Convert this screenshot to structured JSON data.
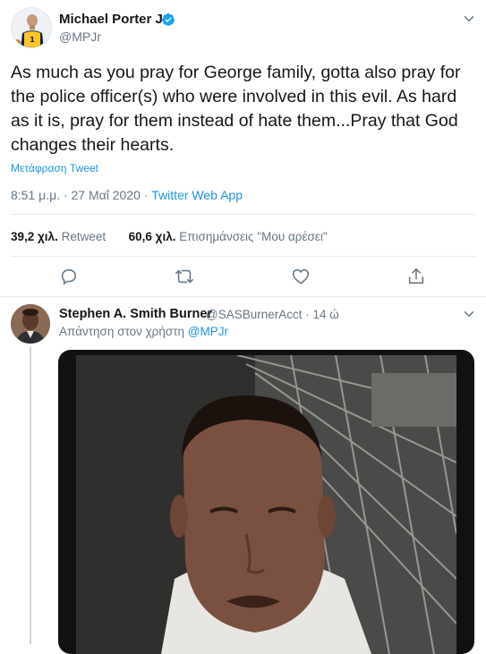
{
  "tweet": {
    "author_name": "Michael Porter Jr",
    "author_handle": "@MPJr",
    "jersey_number": "1",
    "text": "As much as you pray for George family, gotta also pray for the police officer(s) who were involved in this evil. As hard as it is, pray for them instead of hate them...Pray that God changes their hearts.",
    "translate_label": "Μετάφραση Tweet",
    "timestamp": "8:51 μ.μ. · 27 Μαΐ 2020 · ",
    "source_app": "Twitter Web App",
    "retweets_count": "39,2 χιλ.",
    "retweets_label": "Retweet",
    "likes_count": "60,6 χιλ.",
    "likes_label": "Επισημάνσεις \"Μου αρέσει\""
  },
  "reply": {
    "author_name": "Stephen A. Smith Burner",
    "author_handle": "@SASBurnerAcct",
    "time": " · 14 ώ",
    "replying_to_label": "Απάντηση στον χρήστη ",
    "replying_to_handle": "@MPJr"
  },
  "colors": {
    "accent": "#1b95e0",
    "verified": "#1da1f2",
    "muted": "#657786",
    "divider": "#e6ecf0"
  },
  "icons": [
    "verified-badge-icon",
    "chevron-down-icon",
    "reply-icon",
    "retweet-icon",
    "like-icon",
    "share-icon"
  ]
}
